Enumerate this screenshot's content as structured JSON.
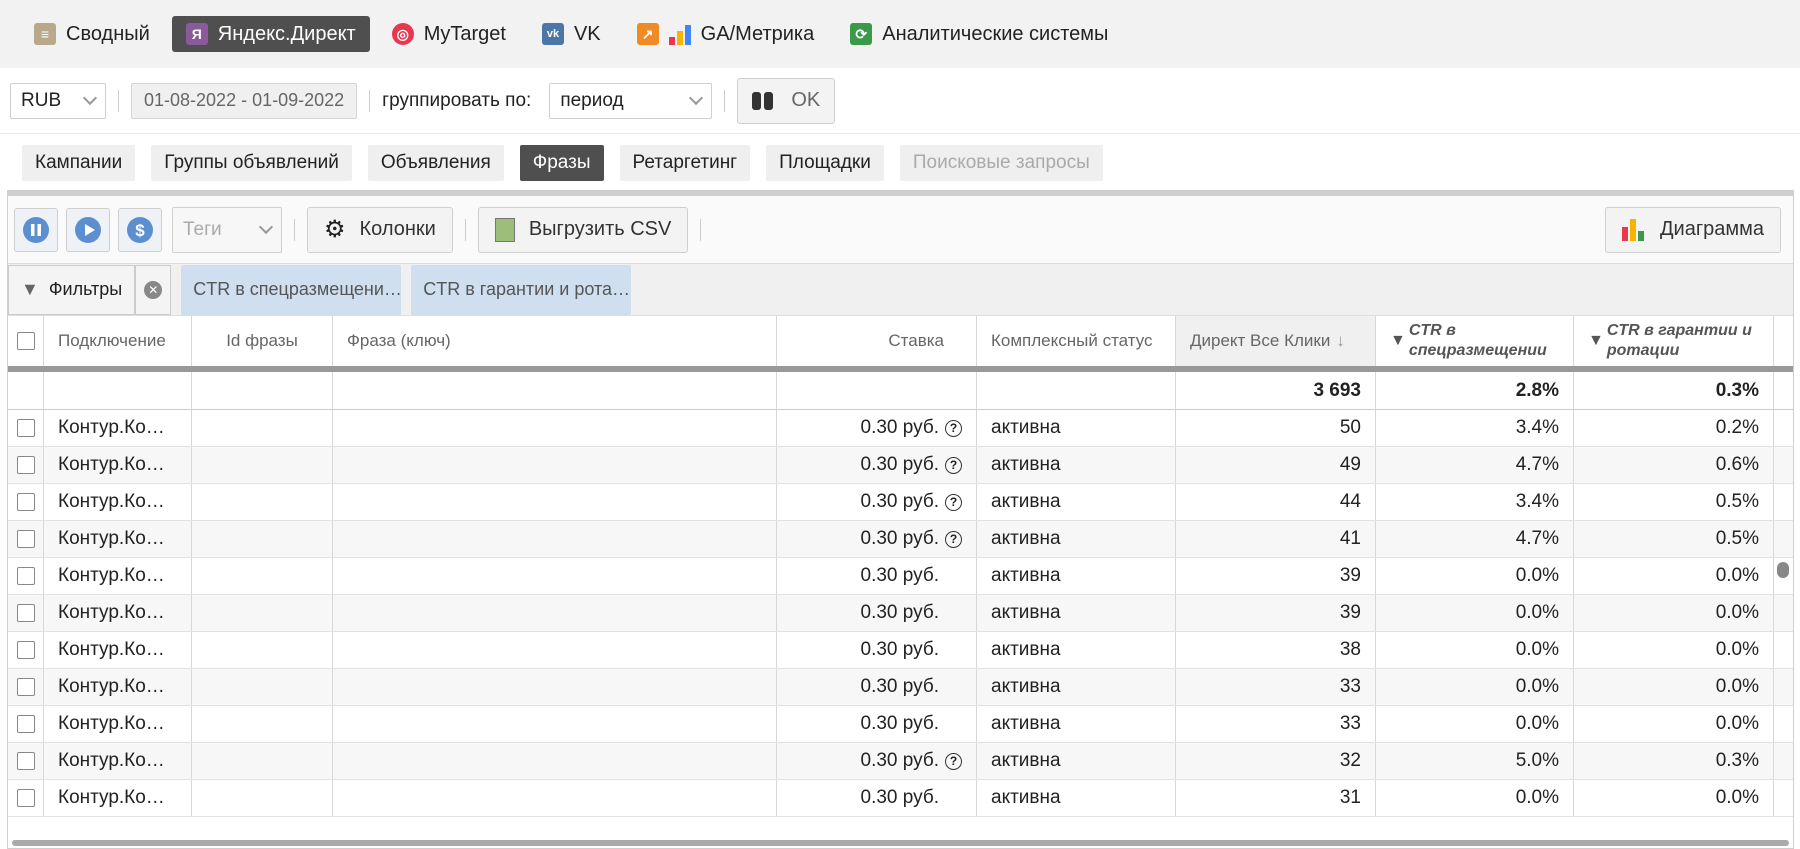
{
  "top_tabs": [
    {
      "label": "Сводный",
      "icon": "database-icon",
      "active": false
    },
    {
      "label": "Яндекс.Директ",
      "icon": "yandex-icon",
      "active": true
    },
    {
      "label": "MyTarget",
      "icon": "target-icon",
      "active": false
    },
    {
      "label": "VK",
      "icon": "vk-icon",
      "active": false
    },
    {
      "label": "GA/Метрика",
      "icon": "analytics-icon",
      "active": false
    },
    {
      "label": "Аналитические системы",
      "icon": "refresh-icon",
      "active": false
    }
  ],
  "controls": {
    "currency": "RUB",
    "date_range": "01-08-2022 - 01-09-2022",
    "group_label": "группировать по:",
    "group_value": "период",
    "ok_label": "OK"
  },
  "sub_tabs": [
    {
      "label": "Кампании",
      "state": "normal"
    },
    {
      "label": "Группы объявлений",
      "state": "normal"
    },
    {
      "label": "Объявления",
      "state": "normal"
    },
    {
      "label": "Фразы",
      "state": "active"
    },
    {
      "label": "Ретаргетинг",
      "state": "normal"
    },
    {
      "label": "Площадки",
      "state": "normal"
    },
    {
      "label": "Поисковые запросы",
      "state": "disabled"
    }
  ],
  "toolbar": {
    "tags_label": "Теги",
    "columns_label": "Колонки",
    "export_label": "Выгрузить CSV",
    "chart_label": "Диаграмма"
  },
  "filters": {
    "label": "Фильтры",
    "chips": [
      "CTR в спецразмещени…",
      "CTR в гарантии и рота…"
    ]
  },
  "table": {
    "headers": {
      "connection": "Подключение",
      "phrase_id": "Id фразы",
      "phrase": "Фраза (ключ)",
      "bid": "Ставка",
      "status": "Комплексный статус",
      "clicks": "Директ Все Клики",
      "ctr_special": "CTR в спецразмещении",
      "ctr_guarantee": "CTR в гарантии и ротации"
    },
    "totals": {
      "clicks": "3 693",
      "ctr_special": "2.8%",
      "ctr_guarantee": "0.3%"
    },
    "rows": [
      {
        "connection": "Контур.Ко…",
        "bid": "0.30 руб.",
        "help": true,
        "status": "активна",
        "clicks": "50",
        "ctr_special": "3.4%",
        "ctr_guarantee": "0.2%"
      },
      {
        "connection": "Контур.Ко…",
        "bid": "0.30 руб.",
        "help": true,
        "status": "активна",
        "clicks": "49",
        "ctr_special": "4.7%",
        "ctr_guarantee": "0.6%"
      },
      {
        "connection": "Контур.Ко…",
        "bid": "0.30 руб.",
        "help": true,
        "status": "активна",
        "clicks": "44",
        "ctr_special": "3.4%",
        "ctr_guarantee": "0.5%"
      },
      {
        "connection": "Контур.Ко…",
        "bid": "0.30 руб.",
        "help": true,
        "status": "активна",
        "clicks": "41",
        "ctr_special": "4.7%",
        "ctr_guarantee": "0.5%"
      },
      {
        "connection": "Контур.Ко…",
        "bid": "0.30 руб.",
        "help": false,
        "status": "активна",
        "clicks": "39",
        "ctr_special": "0.0%",
        "ctr_guarantee": "0.0%"
      },
      {
        "connection": "Контур.Ко…",
        "bid": "0.30 руб.",
        "help": false,
        "status": "активна",
        "clicks": "39",
        "ctr_special": "0.0%",
        "ctr_guarantee": "0.0%"
      },
      {
        "connection": "Контур.Ко…",
        "bid": "0.30 руб.",
        "help": false,
        "status": "активна",
        "clicks": "38",
        "ctr_special": "0.0%",
        "ctr_guarantee": "0.0%"
      },
      {
        "connection": "Контур.Ко…",
        "bid": "0.30 руб.",
        "help": false,
        "status": "активна",
        "clicks": "33",
        "ctr_special": "0.0%",
        "ctr_guarantee": "0.0%"
      },
      {
        "connection": "Контур.Ко…",
        "bid": "0.30 руб.",
        "help": false,
        "status": "активна",
        "clicks": "33",
        "ctr_special": "0.0%",
        "ctr_guarantee": "0.0%"
      },
      {
        "connection": "Контур.Ко…",
        "bid": "0.30 руб.",
        "help": true,
        "status": "активна",
        "clicks": "32",
        "ctr_special": "5.0%",
        "ctr_guarantee": "0.3%"
      },
      {
        "connection": "Контур.Ко…",
        "bid": "0.30 руб.",
        "help": false,
        "status": "активна",
        "clicks": "31",
        "ctr_special": "0.0%",
        "ctr_guarantee": "0.0%"
      }
    ]
  }
}
